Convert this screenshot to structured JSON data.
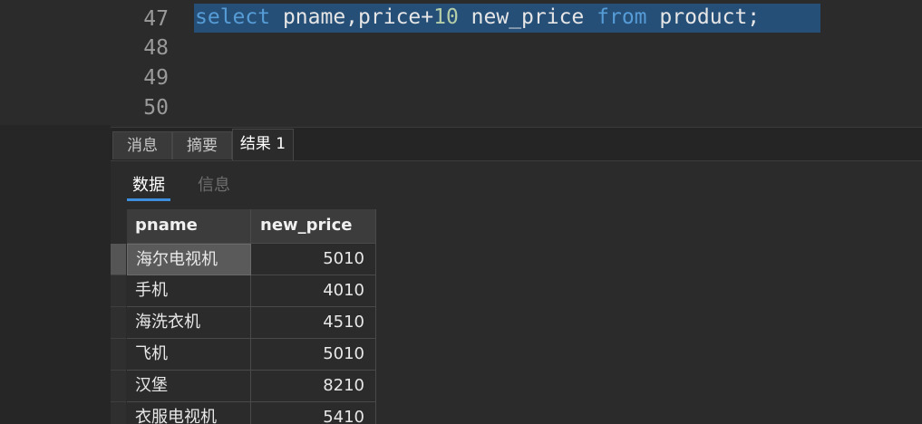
{
  "editor": {
    "lines": [
      {
        "number": "47",
        "tokens": [
          {
            "text": "select",
            "kind": "kw"
          },
          {
            "text": " pname,price+",
            "kind": "plain"
          },
          {
            "text": "10",
            "kind": "num"
          },
          {
            "text": " new_price ",
            "kind": "plain"
          },
          {
            "text": "from",
            "kind": "kw"
          },
          {
            "text": " product;",
            "kind": "plain"
          }
        ]
      },
      {
        "number": "48",
        "tokens": []
      },
      {
        "number": "49",
        "tokens": []
      },
      {
        "number": "50",
        "tokens": []
      }
    ],
    "selected_line": "47"
  },
  "result_tabs": [
    {
      "label": "消息",
      "active": false
    },
    {
      "label": "摘要",
      "active": false
    },
    {
      "label": "结果 1",
      "active": true
    }
  ],
  "sub_tabs": [
    {
      "label": "数据",
      "active": true
    },
    {
      "label": "信息",
      "active": false
    }
  ],
  "grid": {
    "columns": [
      "pname",
      "new_price"
    ],
    "rows": [
      [
        "海尔电视机",
        "5010"
      ],
      [
        "手机",
        "4010"
      ],
      [
        "海洗衣机",
        "4510"
      ],
      [
        "飞机",
        "5010"
      ],
      [
        "汉堡",
        "8210"
      ],
      [
        "衣服电视机",
        "5410"
      ]
    ],
    "selected_row": 0
  },
  "colors": {
    "background": "#2b2b2b",
    "keyword": "#569cd6",
    "number": "#b5cea8",
    "selection": "#264f78",
    "accent": "#3e8ede"
  }
}
